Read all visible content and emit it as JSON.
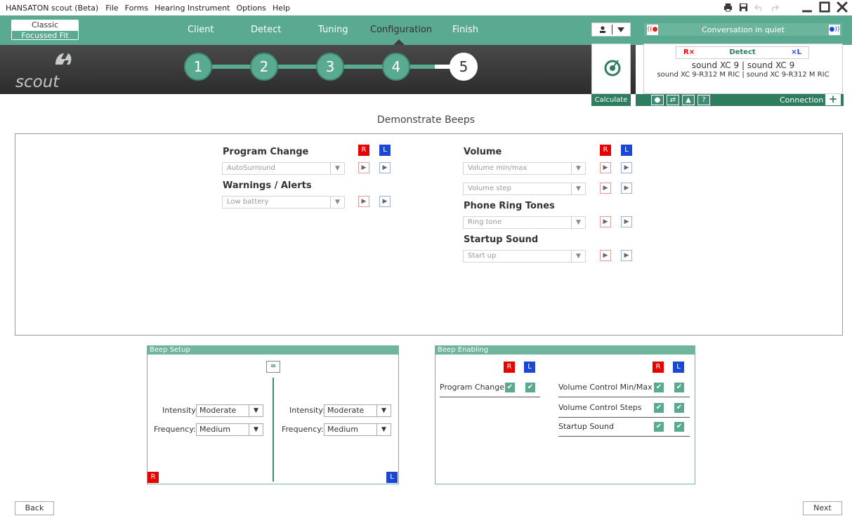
{
  "titlebar": {
    "app_title": "HANSATON scout (Beta)",
    "menu": [
      "File",
      "Forms",
      "Hearing Instrument",
      "Options",
      "Help"
    ]
  },
  "nav": {
    "mode_classic": "Classic",
    "mode_focussed": "Focussed Fit",
    "tabs": [
      "Client",
      "Detect",
      "Tuning",
      "Configuration",
      "Finish"
    ],
    "active_tab": "Configuration"
  },
  "logo": {
    "text": "scout"
  },
  "steps": [
    "1",
    "2",
    "3",
    "4",
    "5"
  ],
  "program_selector": {
    "label": "Conversation in quiet"
  },
  "calculate": {
    "label": "Calculate"
  },
  "device": {
    "right_marker": "R×",
    "detect_label": "Detect",
    "left_marker": "×L",
    "right_name": "sound XC 9",
    "right_model": "sound XC 9-R312 M RIC",
    "left_name": "sound XC 9",
    "left_model": "sound XC 9-R312 M RIC",
    "separator": "|"
  },
  "connection": {
    "label": "Connection",
    "add": "+"
  },
  "page": {
    "title": "Demonstrate Beeps"
  },
  "ear": {
    "right": "R",
    "left": "L"
  },
  "beeps": {
    "program_change": {
      "title": "Program Change",
      "value": "AutoSurround"
    },
    "warnings": {
      "title": "Warnings / Alerts",
      "value": "Low battery"
    },
    "volume": {
      "title": "Volume",
      "value1": "Volume min/max",
      "value2": "Volume step"
    },
    "phone": {
      "title": "Phone Ring Tones",
      "value": "Ring tone"
    },
    "startup": {
      "title": "Startup Sound",
      "value": "Start up"
    }
  },
  "beep_setup": {
    "title": "Beep Setup",
    "intensity_label": "Intensity:",
    "frequency_label": "Frequency:",
    "right_intensity": "Moderate",
    "right_frequency": "Medium",
    "left_intensity": "Moderate",
    "left_frequency": "Medium"
  },
  "beep_enabling": {
    "title": "Beep Enabling",
    "program_change": "Program Change",
    "vc_minmax": "Volume Control Min/Max",
    "vc_steps": "Volume Control Steps",
    "startup": "Startup Sound"
  },
  "footer": {
    "back": "Back",
    "next": "Next"
  },
  "colors": {
    "accent": "#5aa991",
    "right_ear": "#e60000",
    "left_ear": "#1b47d6"
  }
}
